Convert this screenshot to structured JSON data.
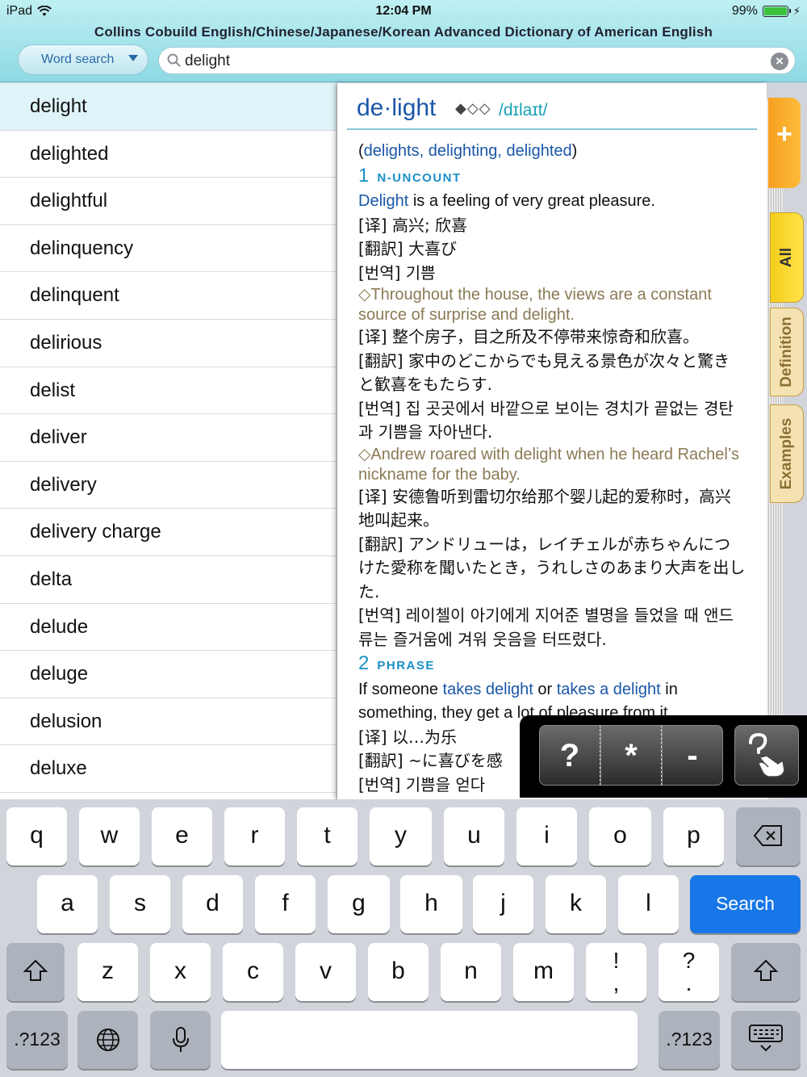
{
  "status_bar": {
    "device": "iPad",
    "time": "12:04 PM",
    "battery": "99%",
    "battery_level": 0.99
  },
  "app": {
    "title": "Collins Cobuild English/Chinese/Japanese/Korean Advanced Dictionary of American English"
  },
  "search": {
    "mode_label": "Word search",
    "query": "delight"
  },
  "word_list": {
    "selected_index": 0,
    "items": [
      "delight",
      "delighted",
      "delightful",
      "delinquency",
      "delinquent",
      "delirious",
      "delist",
      "deliver",
      "delivery",
      "delivery charge",
      "delta",
      "delude",
      "deluge",
      "delusion",
      "deluxe"
    ]
  },
  "entry": {
    "headword": "de·light",
    "frequency": "◆◇◇",
    "pronunciation": "/dɪlaɪt/",
    "inflections": {
      "open": "(",
      "forms": "delights, delighting, delighted",
      "close": ")"
    },
    "senses": [
      {
        "number": "1",
        "pos": "N-UNCOUNT",
        "definition": {
          "term": "Delight",
          "rest": " is a feeling of very great pleasure."
        },
        "translations": [
          "[译] 高兴; 欣喜",
          "[翻訳] 大喜び",
          "[번역] 기쁨"
        ],
        "examples": [
          {
            "text": "◇Throughout the house, the views are a constant source of surprise and delight.",
            "translations": [
              "[译] 整个房子，目之所及不停带来惊奇和欣喜。",
              "[翻訳] 家中のどこからでも見える景色が次々と驚きと歓喜をもたらす.",
              "[번역] 집 곳곳에서 바깥으로 보이는 경치가 끝없는 경탄과 기쁨을 자아낸다."
            ]
          },
          {
            "text": "◇Andrew roared with delight when he heard Rachel’s nickname for the baby.",
            "translations": [
              "[译] 安德鲁听到雷切尔给那个婴儿起的爱称时，高兴地叫起来。",
              "[翻訳] アンドリューは，レイチェルが赤ちゃんにつけた愛称を聞いたとき，うれしさのあまり大声を出した.",
              "[번역] 레이첼이 아기에게 지어준 별명을 들었을 때 앤드류는 즐거움에 겨워 웃음을 터뜨렸다."
            ]
          }
        ]
      },
      {
        "number": "2",
        "pos": "PHRASE",
        "definition": {
          "p1": "If someone ",
          "l1": "takes delight",
          "p2": " or ",
          "l2": "takes a delight",
          "p3": " in something, they get a lot of pleasure from it."
        },
        "translations": [
          "[译] 以…为乐",
          "[翻訳] ~に喜びを感",
          "[번역] 기쁨을 얻다"
        ]
      }
    ]
  },
  "side_tabs": {
    "add": "+",
    "all": "All",
    "definition": "Definition",
    "examples": "Examples"
  },
  "wildcards": {
    "question": "?",
    "star": "*",
    "minus": "-"
  },
  "keyboard": {
    "row1": [
      "q",
      "w",
      "e",
      "r",
      "t",
      "y",
      "u",
      "i",
      "o",
      "p"
    ],
    "row2": [
      "a",
      "s",
      "d",
      "f",
      "g",
      "h",
      "j",
      "k",
      "l"
    ],
    "row3": [
      "z",
      "x",
      "c",
      "v",
      "b",
      "n",
      "m"
    ],
    "punct1": {
      "top": "!",
      "bottom": ","
    },
    "punct2": {
      "top": "?",
      "bottom": "."
    },
    "search_label": "Search",
    "numbers_label": ".?123"
  },
  "colors": {
    "header": "#8ed9e4",
    "accent_blue": "#1a57a8",
    "search_key": "#1877e8",
    "tab_orange": "#f7a021",
    "tab_yellow": "#f4cd1a"
  }
}
